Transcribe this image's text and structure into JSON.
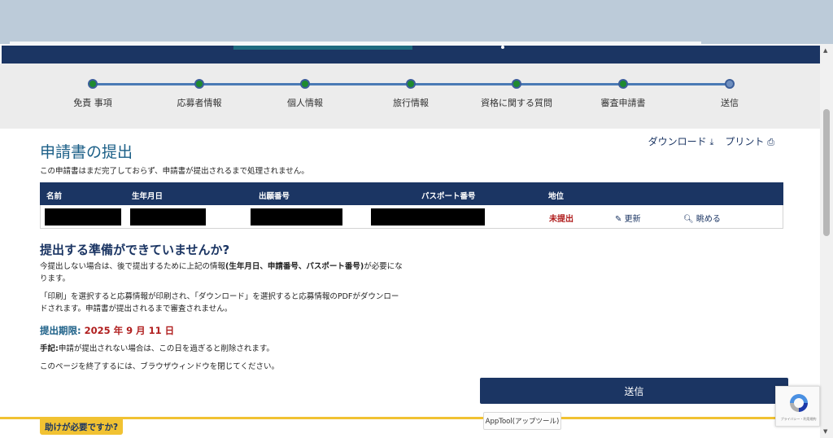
{
  "steps": [
    "免責 事項",
    "応募者情報",
    "個人情報",
    "旅行情報",
    "資格に関する質問",
    "審査申請書",
    "送信"
  ],
  "page": {
    "title": "申請書の提出",
    "intro": "この申請書はまだ完了しておらず、申請書が提出されるまで処理されません。",
    "download_label": "ダウンロード",
    "print_label": "プリント"
  },
  "table": {
    "headers": [
      "名前",
      "生年月日",
      "出願番号",
      "パスポート番号",
      "地位"
    ],
    "row": {
      "status": "未提出",
      "edit_label": "更新",
      "view_label": "眺める"
    }
  },
  "ready": {
    "title": "提出する準備ができていませんか?",
    "para1_a": "今提出しない場合は、後で提出するために上記の情報",
    "para1_b": "(生年月日、申請番号、パスポート番号)",
    "para1_c": "が必要になります。",
    "para2": "「印刷」を選択すると応募情報が印刷され、「ダウンロード」を選択すると応募情報のPDFがダウンロードされます。申請書が提出されるまで審査されません。",
    "deadline_label": "提出期限:",
    "deadline_value": "2025 年 9 月 11 日",
    "note_label": "手記:",
    "note_text": "申請が提出されない場合は、この日を過ぎると削除されます。",
    "exit_text": "このページを終了するには、ブラウザウィンドウを閉じてください。"
  },
  "submit_label": "送信",
  "help_label": "助けが必要ですか?",
  "apptool_label": "AppTool(アップツール)",
  "recaptcha_fine": "プライバシー・利用規約",
  "colors": {
    "navy": "#1b3563",
    "teal_text": "#1b5f87",
    "status_red": "#b01e1e",
    "accent_yellow": "#f1c232"
  }
}
